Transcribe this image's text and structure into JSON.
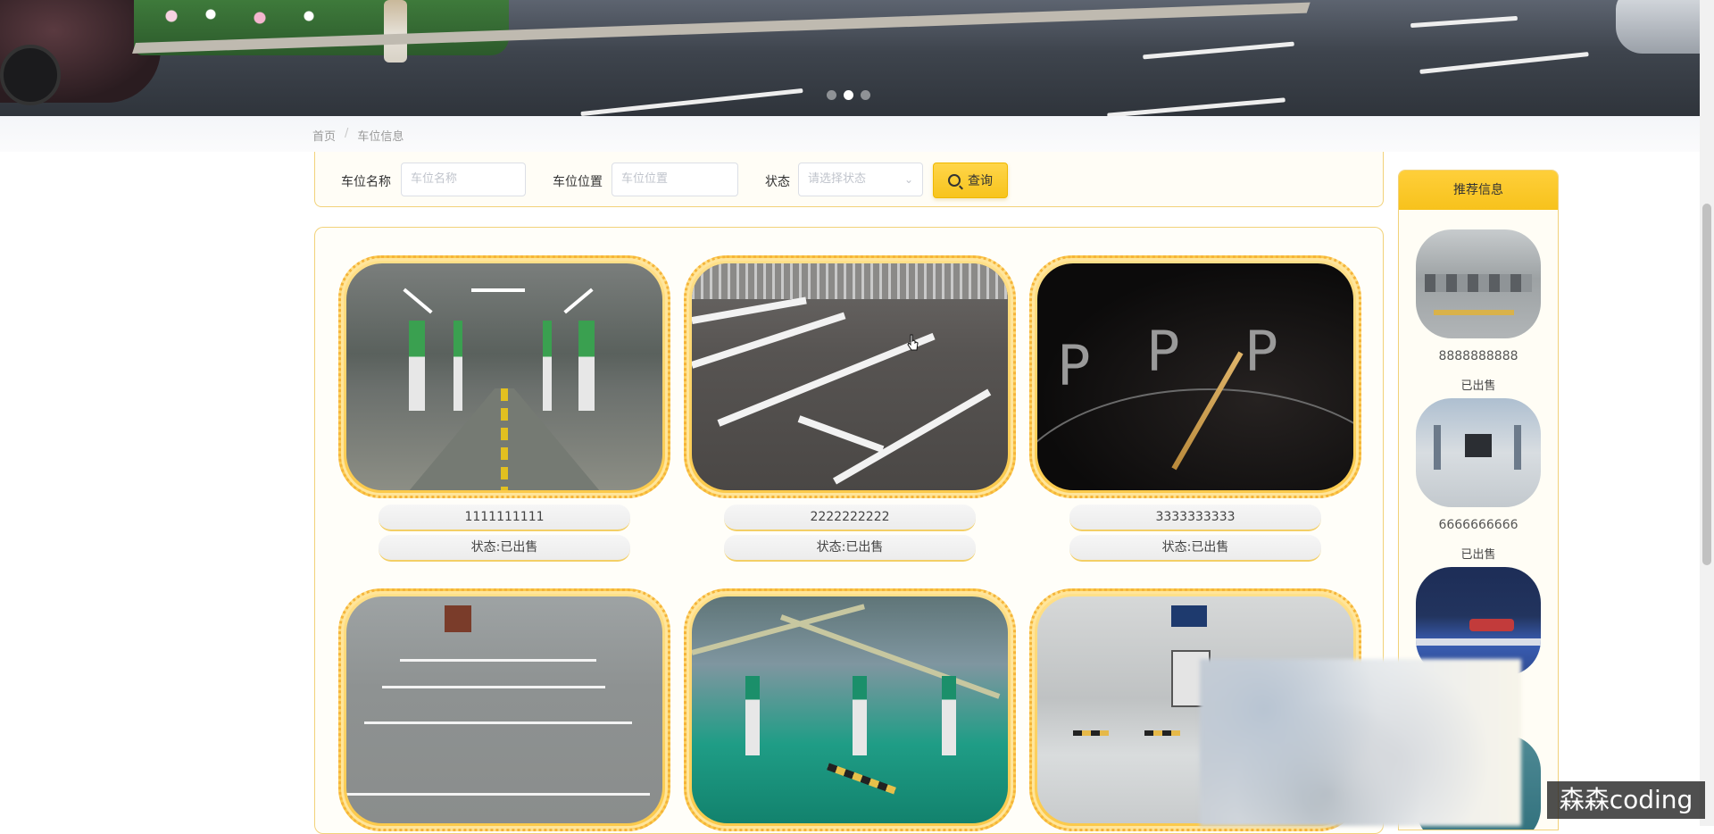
{
  "banner": {
    "carousel_dots": 3,
    "active_dot_index": 1
  },
  "breadcrumb": {
    "home": "首页",
    "separator": "/",
    "current": "车位信息"
  },
  "search": {
    "name_label": "车位名称",
    "name_placeholder": "车位名称",
    "location_label": "车位位置",
    "location_placeholder": "车位位置",
    "status_label": "状态",
    "status_placeholder": "请选择状态",
    "query_button": "查询"
  },
  "spots": [
    {
      "name": "1111111111",
      "status": "状态:已出售",
      "image": "underground-tunnel"
    },
    {
      "name": "2222222222",
      "status": "状态:已出售",
      "image": "outdoor-lot"
    },
    {
      "name": "3333333333",
      "status": "状态:已出售",
      "image": "dark-p-sign"
    },
    {
      "name": "",
      "status": "",
      "image": "gray-garage"
    },
    {
      "name": "",
      "status": "",
      "image": "green-garage"
    },
    {
      "name": "",
      "status": "",
      "image": "lit-garage"
    }
  ],
  "sidebar": {
    "title": "推荐信息",
    "items": [
      {
        "name": "8888888888",
        "status": "已出售"
      },
      {
        "name": "6666666666",
        "status": "已出售"
      },
      {
        "name": "",
        "status": ""
      }
    ]
  },
  "watermark": "森森coding",
  "colors": {
    "accent": "#f7c41c",
    "border": "#f2d27a",
    "frame": "#f5b43a"
  }
}
